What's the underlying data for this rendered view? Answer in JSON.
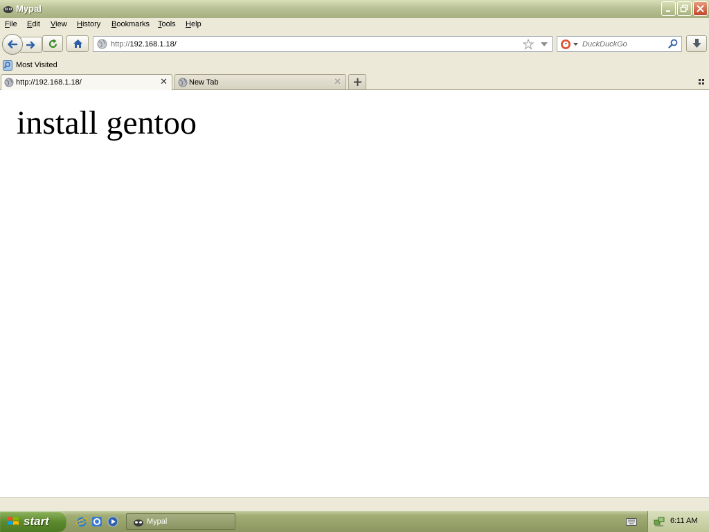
{
  "window": {
    "title": "Mypal"
  },
  "menu": {
    "items": [
      {
        "label": "File",
        "accel": "F",
        "rest": "ile"
      },
      {
        "label": "Edit",
        "accel": "E",
        "rest": "dit"
      },
      {
        "label": "View",
        "accel": "V",
        "rest": "iew"
      },
      {
        "label": "History",
        "accel": "H",
        "rest": "istory"
      },
      {
        "label": "Bookmarks",
        "accel": "B",
        "rest": "ookmarks"
      },
      {
        "label": "Tools",
        "accel": "T",
        "rest": "ools"
      },
      {
        "label": "Help",
        "accel": "H",
        "rest": "elp"
      }
    ]
  },
  "navbar": {
    "url_protocol": "http://",
    "url_host": "192.168.1.18/",
    "search_placeholder": "DuckDuckGo"
  },
  "bookmarks": {
    "most_visited": "Most Visited"
  },
  "tabs": [
    {
      "label": "http://192.168.1.18/",
      "active": true
    },
    {
      "label": "New Tab",
      "active": false
    }
  ],
  "page": {
    "heading": "install gentoo"
  },
  "taskbar": {
    "start_label": "start",
    "task_label": "Mypal",
    "clock": "6:11 AM"
  },
  "colors": {
    "titlebar": "#A6AF80",
    "chrome": "#ECE9D8",
    "start_button": "#5E8A2E"
  }
}
